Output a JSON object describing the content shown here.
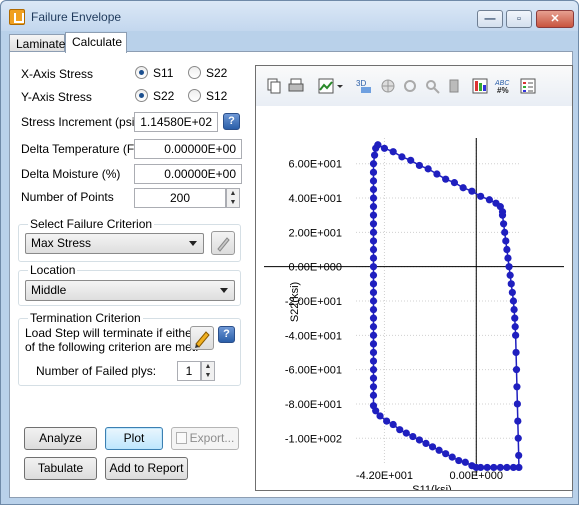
{
  "window": {
    "title": "Failure Envelope",
    "min_glyph": "—",
    "max_glyph": "▫",
    "close_glyph": "✕"
  },
  "tabs": [
    {
      "label": "Laminate"
    },
    {
      "label": "Calculate"
    }
  ],
  "axis_stress": {
    "x_label": "X-Axis Stress",
    "y_label": "Y-Axis Stress",
    "x_options": [
      {
        "label": "S11",
        "selected": true
      },
      {
        "label": "S22",
        "selected": false
      }
    ],
    "y_options": [
      {
        "label": "S22",
        "selected": true
      },
      {
        "label": "S12",
        "selected": false
      }
    ]
  },
  "stress_increment": {
    "label": "Stress Increment (psi)",
    "value": "1.14580E+02",
    "help_glyph": "?"
  },
  "delta_temperature": {
    "label": "Delta Temperature (F)",
    "value": "0.00000E+00"
  },
  "delta_moisture": {
    "label": "Delta Moisture (%)",
    "value": "0.00000E+00"
  },
  "number_of_points": {
    "label": "Number of Points",
    "value": "200"
  },
  "failure_criterion": {
    "title": "Select Failure Criterion",
    "selected": "Max Stress"
  },
  "location": {
    "title": "Location",
    "selected": "Middle"
  },
  "termination": {
    "title": "Termination Criterion",
    "text_line1": "Load Step will terminate if either",
    "text_line2": "of the following criterion are met:",
    "failed_plys_label": "Number of Failed plys:",
    "failed_plys_value": "1",
    "help_glyph": "?"
  },
  "buttons": {
    "analyze": "Analyze",
    "plot": "Plot",
    "export": "Export...",
    "tabulate": "Tabulate",
    "add_to_report": "Add to Report"
  },
  "toolbar_icons": [
    "copy-icon",
    "print-icon",
    "chart-type-icon",
    "dropdown-arrow-icon",
    "3d-icon",
    "pan-icon",
    "rotate-icon",
    "zoom-icon",
    "eraser-icon",
    "palette-icon",
    "number-format-icon",
    "legend-icon"
  ],
  "toolbar_text": {
    "three_d": "3D",
    "abc": "ABC",
    "hash": "#%"
  },
  "colors": {
    "series": "#1f1fbf",
    "help": "#2a5ea8",
    "frame": "#b9d1ea"
  },
  "chart_data": {
    "type": "line",
    "xlabel": "S11(ksi)",
    "ylabel": "S22(ksi)",
    "xlim": [
      -55,
      20
    ],
    "ylim": [
      -115,
      75
    ],
    "y_ticks": [
      60,
      40,
      20,
      0,
      -20,
      -40,
      -60,
      -80,
      -100
    ],
    "y_tick_labels": [
      "6.00E+001",
      "4.00E+001",
      "2.00E+001",
      "0.00E+000",
      "-2.00E+001",
      "-4.00E+001",
      "-6.00E+001",
      "-8.00E+001",
      "-1.00E+002"
    ],
    "x_ticks": [
      -42,
      0
    ],
    "x_tick_labels": [
      "-4.20E+001",
      "0.00E+000"
    ],
    "grid": true,
    "series": [
      {
        "values_xy": [
          [
            -45,
            71
          ],
          [
            -42,
            69
          ],
          [
            -38,
            67
          ],
          [
            -34,
            64
          ],
          [
            -30,
            62
          ],
          [
            -26,
            59
          ],
          [
            -22,
            57
          ],
          [
            -18,
            54
          ],
          [
            -14,
            51
          ],
          [
            -10,
            49
          ],
          [
            -6,
            46
          ],
          [
            -2,
            44
          ],
          [
            2,
            41
          ],
          [
            6,
            39
          ],
          [
            9,
            37
          ],
          [
            11,
            35
          ],
          [
            12,
            32
          ],
          [
            12,
            30
          ],
          [
            12.5,
            25
          ],
          [
            13,
            20
          ],
          [
            13.5,
            15
          ],
          [
            14,
            10
          ],
          [
            14.5,
            5
          ],
          [
            15,
            0
          ],
          [
            15.5,
            -5
          ],
          [
            16,
            -10
          ],
          [
            16.5,
            -15
          ],
          [
            17,
            -20
          ],
          [
            17.3,
            -25
          ],
          [
            17.6,
            -30
          ],
          [
            17.8,
            -35
          ],
          [
            18,
            -40
          ],
          [
            18.2,
            -50
          ],
          [
            18.4,
            -60
          ],
          [
            18.6,
            -70
          ],
          [
            18.8,
            -80
          ],
          [
            19,
            -90
          ],
          [
            19.2,
            -100
          ],
          [
            19.4,
            -110
          ],
          [
            19.5,
            -117
          ],
          [
            17,
            -117
          ],
          [
            14,
            -117
          ],
          [
            11,
            -117
          ],
          [
            8,
            -117
          ],
          [
            5,
            -117
          ],
          [
            2,
            -117
          ],
          [
            0,
            -117
          ],
          [
            -2,
            -116
          ],
          [
            -5,
            -114
          ],
          [
            -8,
            -113
          ],
          [
            -11,
            -111
          ],
          [
            -14,
            -109
          ],
          [
            -17,
            -107
          ],
          [
            -20,
            -105
          ],
          [
            -23,
            -103
          ],
          [
            -26,
            -101
          ],
          [
            -29,
            -99
          ],
          [
            -32,
            -97
          ],
          [
            -35,
            -95
          ],
          [
            -38,
            -92
          ],
          [
            -41,
            -90
          ],
          [
            -44,
            -87
          ],
          [
            -46,
            -84
          ],
          [
            -47,
            -81
          ],
          [
            -47,
            -75
          ],
          [
            -47,
            -70
          ],
          [
            -47,
            -65
          ],
          [
            -47,
            -60
          ],
          [
            -47,
            -55
          ],
          [
            -47,
            -50
          ],
          [
            -47,
            -45
          ],
          [
            -47,
            -40
          ],
          [
            -47,
            -35
          ],
          [
            -47,
            -30
          ],
          [
            -47,
            -25
          ],
          [
            -47,
            -20
          ],
          [
            -47,
            -15
          ],
          [
            -47,
            -10
          ],
          [
            -47,
            -5
          ],
          [
            -47,
            0
          ],
          [
            -47,
            5
          ],
          [
            -47,
            10
          ],
          [
            -47,
            15
          ],
          [
            -47,
            20
          ],
          [
            -47,
            25
          ],
          [
            -47,
            30
          ],
          [
            -47,
            35
          ],
          [
            -47,
            40
          ],
          [
            -47,
            45
          ],
          [
            -47,
            50
          ],
          [
            -47,
            55
          ],
          [
            -47,
            60
          ],
          [
            -46.5,
            65
          ],
          [
            -46,
            69
          ],
          [
            -45,
            71
          ]
        ]
      }
    ]
  }
}
